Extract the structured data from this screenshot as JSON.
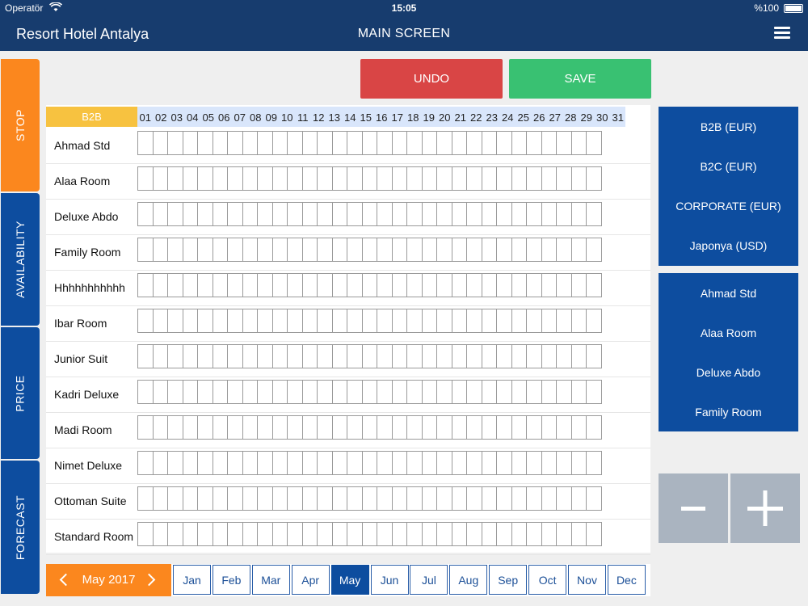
{
  "status_bar": {
    "carrier": "Operatör",
    "time": "15:05",
    "battery": "%100"
  },
  "nav": {
    "hotel_name": "Resort Hotel Antalya",
    "screen_title": "MAIN SCREEN"
  },
  "side_tabs": [
    {
      "label": "STOP",
      "color": "#fb871e"
    },
    {
      "label": "AVAILABILITY",
      "color": "#0d4d9f"
    },
    {
      "label": "PRICE",
      "color": "#0d4d9f"
    },
    {
      "label": "FORECAST",
      "color": "#0d4d9f"
    }
  ],
  "actions": {
    "undo": "UNDO",
    "save": "SAVE",
    "undo_color": "#d94545",
    "save_color": "#39c172"
  },
  "grid": {
    "channel": "B2B",
    "days": [
      "01",
      "02",
      "03",
      "04",
      "05",
      "06",
      "07",
      "08",
      "09",
      "10",
      "11",
      "12",
      "13",
      "14",
      "15",
      "16",
      "17",
      "18",
      "19",
      "20",
      "21",
      "22",
      "23",
      "24",
      "25",
      "26",
      "27",
      "28",
      "29",
      "30",
      "31"
    ],
    "rooms": [
      "Ahmad Std",
      "Alaa Room",
      "Deluxe Abdo",
      "Family Room",
      "Hhhhhhhhhhh",
      "Ibar Room",
      "Junior Suit",
      "Kadri Deluxe",
      "Madi Room",
      "Nimet Deluxe",
      "Ottoman Suite",
      "Standard Room"
    ]
  },
  "channels": [
    "B2B (EUR)",
    "B2C (EUR)",
    "CORPORATE (EUR)",
    "Japonya (USD)"
  ],
  "room_filter": [
    "Ahmad Std",
    "Alaa Room",
    "Deluxe Abdo",
    "Family Room"
  ],
  "stepper": {
    "minus": "−",
    "plus": "+"
  },
  "month_bar": {
    "current": "May 2017",
    "months": [
      "Jan",
      "Feb",
      "Mar",
      "Apr",
      "May",
      "Jun",
      "Jul",
      "Aug",
      "Sep",
      "Oct",
      "Nov",
      "Dec"
    ],
    "active_month": "May"
  }
}
